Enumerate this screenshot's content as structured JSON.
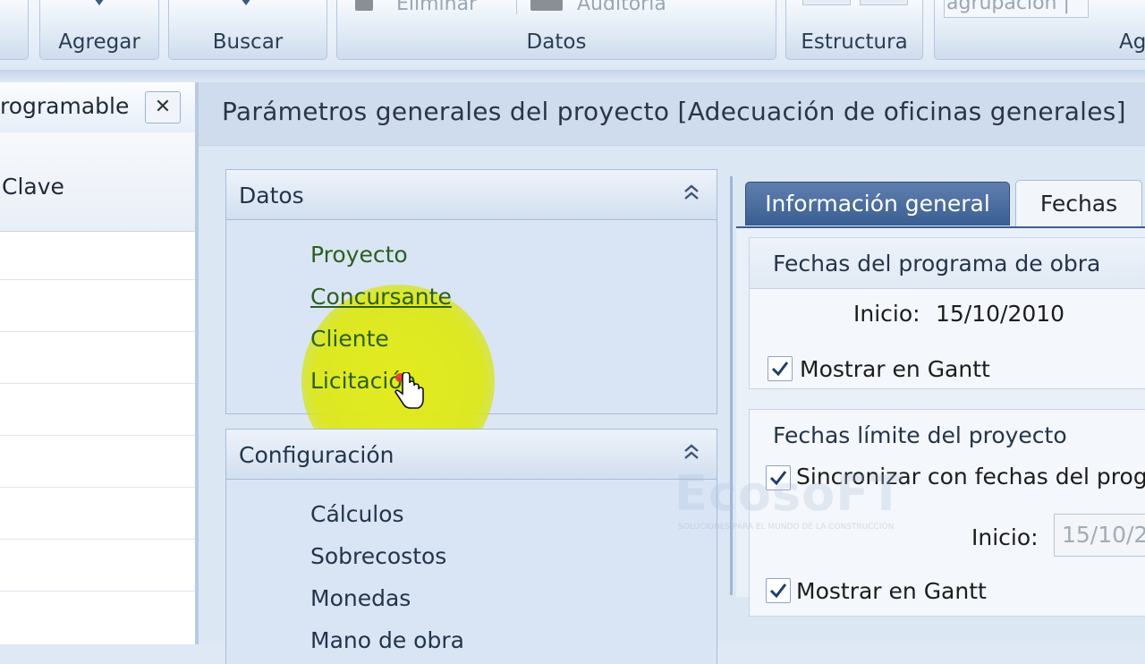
{
  "ribbon": {
    "groups": [
      {
        "label": "Agregar"
      },
      {
        "label": "Buscar"
      },
      {
        "label": "Datos"
      },
      {
        "label": "Estructura"
      },
      {
        "label": "Ag"
      }
    ],
    "faded_items": [
      "Eliminar",
      "Auditoría",
      "agrupación |"
    ]
  },
  "left_panel": {
    "tab_title": "rogramable",
    "close_glyph": "✕",
    "column_header": "Clave"
  },
  "dialog": {
    "title": "Parámetros generales del proyecto [Adecuación de oficinas generales]",
    "nav": {
      "datos": {
        "header": "Datos",
        "collapse_glyph": "⌃",
        "items": [
          "Proyecto",
          "Concursante",
          "Cliente",
          "Licitación"
        ]
      },
      "configuracion": {
        "header": "Configuración",
        "collapse_glyph": "⌃",
        "items": [
          "Cálculos",
          "Sobrecostos",
          "Monedas",
          "Mano de obra"
        ]
      }
    },
    "tabs": [
      "Información general",
      "Fechas"
    ],
    "fechas": {
      "programa": {
        "header": "Fechas del programa de obra",
        "inicio_label": "Inicio:",
        "inicio_value": "15/10/2010",
        "gantt_label": "Mostrar en Gantt",
        "gantt_checked": true
      },
      "limite": {
        "header": "Fechas límite del proyecto",
        "sync_label": "Sincronizar con fechas del prog",
        "sync_checked": true,
        "inicio_label": "Inicio:",
        "inicio_value": "15/10/2",
        "gantt_label": "Mostrar en Gantt",
        "gantt_checked": true
      }
    }
  },
  "watermark": {
    "brand": "EcosoFT",
    "tagline": "SOLUCIONES PARA EL MUNDO DE LA CONSTRUCCIÓN"
  },
  "colors": {
    "nav_link": "#2c5f1e",
    "active_tab": "#3a5e93",
    "highlight": "#e4ec14"
  }
}
